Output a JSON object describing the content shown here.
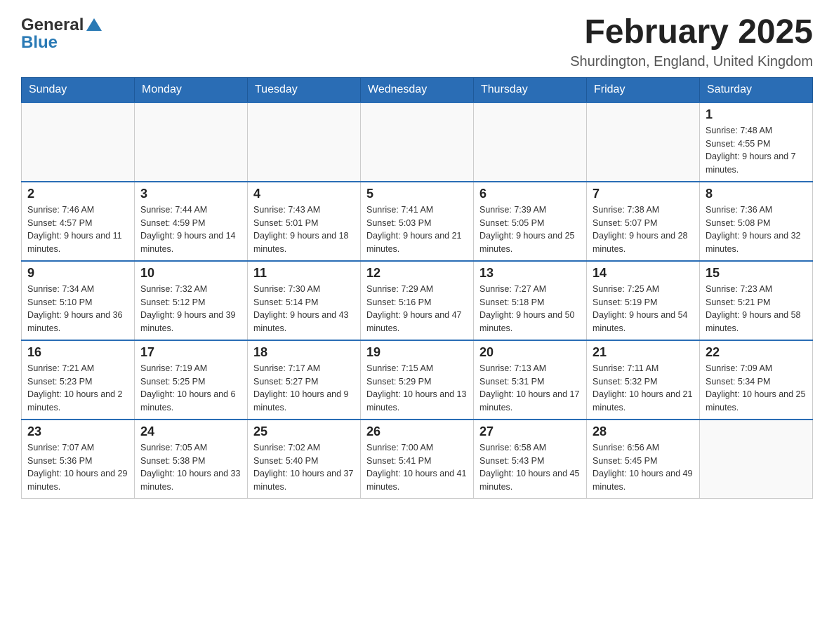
{
  "header": {
    "logo": {
      "general": "General",
      "blue": "Blue"
    },
    "title": "February 2025",
    "location": "Shurdington, England, United Kingdom"
  },
  "days_of_week": [
    "Sunday",
    "Monday",
    "Tuesday",
    "Wednesday",
    "Thursday",
    "Friday",
    "Saturday"
  ],
  "weeks": [
    [
      {
        "day": "",
        "info": ""
      },
      {
        "day": "",
        "info": ""
      },
      {
        "day": "",
        "info": ""
      },
      {
        "day": "",
        "info": ""
      },
      {
        "day": "",
        "info": ""
      },
      {
        "day": "",
        "info": ""
      },
      {
        "day": "1",
        "info": "Sunrise: 7:48 AM\nSunset: 4:55 PM\nDaylight: 9 hours and 7 minutes."
      }
    ],
    [
      {
        "day": "2",
        "info": "Sunrise: 7:46 AM\nSunset: 4:57 PM\nDaylight: 9 hours and 11 minutes."
      },
      {
        "day": "3",
        "info": "Sunrise: 7:44 AM\nSunset: 4:59 PM\nDaylight: 9 hours and 14 minutes."
      },
      {
        "day": "4",
        "info": "Sunrise: 7:43 AM\nSunset: 5:01 PM\nDaylight: 9 hours and 18 minutes."
      },
      {
        "day": "5",
        "info": "Sunrise: 7:41 AM\nSunset: 5:03 PM\nDaylight: 9 hours and 21 minutes."
      },
      {
        "day": "6",
        "info": "Sunrise: 7:39 AM\nSunset: 5:05 PM\nDaylight: 9 hours and 25 minutes."
      },
      {
        "day": "7",
        "info": "Sunrise: 7:38 AM\nSunset: 5:07 PM\nDaylight: 9 hours and 28 minutes."
      },
      {
        "day": "8",
        "info": "Sunrise: 7:36 AM\nSunset: 5:08 PM\nDaylight: 9 hours and 32 minutes."
      }
    ],
    [
      {
        "day": "9",
        "info": "Sunrise: 7:34 AM\nSunset: 5:10 PM\nDaylight: 9 hours and 36 minutes."
      },
      {
        "day": "10",
        "info": "Sunrise: 7:32 AM\nSunset: 5:12 PM\nDaylight: 9 hours and 39 minutes."
      },
      {
        "day": "11",
        "info": "Sunrise: 7:30 AM\nSunset: 5:14 PM\nDaylight: 9 hours and 43 minutes."
      },
      {
        "day": "12",
        "info": "Sunrise: 7:29 AM\nSunset: 5:16 PM\nDaylight: 9 hours and 47 minutes."
      },
      {
        "day": "13",
        "info": "Sunrise: 7:27 AM\nSunset: 5:18 PM\nDaylight: 9 hours and 50 minutes."
      },
      {
        "day": "14",
        "info": "Sunrise: 7:25 AM\nSunset: 5:19 PM\nDaylight: 9 hours and 54 minutes."
      },
      {
        "day": "15",
        "info": "Sunrise: 7:23 AM\nSunset: 5:21 PM\nDaylight: 9 hours and 58 minutes."
      }
    ],
    [
      {
        "day": "16",
        "info": "Sunrise: 7:21 AM\nSunset: 5:23 PM\nDaylight: 10 hours and 2 minutes."
      },
      {
        "day": "17",
        "info": "Sunrise: 7:19 AM\nSunset: 5:25 PM\nDaylight: 10 hours and 6 minutes."
      },
      {
        "day": "18",
        "info": "Sunrise: 7:17 AM\nSunset: 5:27 PM\nDaylight: 10 hours and 9 minutes."
      },
      {
        "day": "19",
        "info": "Sunrise: 7:15 AM\nSunset: 5:29 PM\nDaylight: 10 hours and 13 minutes."
      },
      {
        "day": "20",
        "info": "Sunrise: 7:13 AM\nSunset: 5:31 PM\nDaylight: 10 hours and 17 minutes."
      },
      {
        "day": "21",
        "info": "Sunrise: 7:11 AM\nSunset: 5:32 PM\nDaylight: 10 hours and 21 minutes."
      },
      {
        "day": "22",
        "info": "Sunrise: 7:09 AM\nSunset: 5:34 PM\nDaylight: 10 hours and 25 minutes."
      }
    ],
    [
      {
        "day": "23",
        "info": "Sunrise: 7:07 AM\nSunset: 5:36 PM\nDaylight: 10 hours and 29 minutes."
      },
      {
        "day": "24",
        "info": "Sunrise: 7:05 AM\nSunset: 5:38 PM\nDaylight: 10 hours and 33 minutes."
      },
      {
        "day": "25",
        "info": "Sunrise: 7:02 AM\nSunset: 5:40 PM\nDaylight: 10 hours and 37 minutes."
      },
      {
        "day": "26",
        "info": "Sunrise: 7:00 AM\nSunset: 5:41 PM\nDaylight: 10 hours and 41 minutes."
      },
      {
        "day": "27",
        "info": "Sunrise: 6:58 AM\nSunset: 5:43 PM\nDaylight: 10 hours and 45 minutes."
      },
      {
        "day": "28",
        "info": "Sunrise: 6:56 AM\nSunset: 5:45 PM\nDaylight: 10 hours and 49 minutes."
      },
      {
        "day": "",
        "info": ""
      }
    ]
  ]
}
